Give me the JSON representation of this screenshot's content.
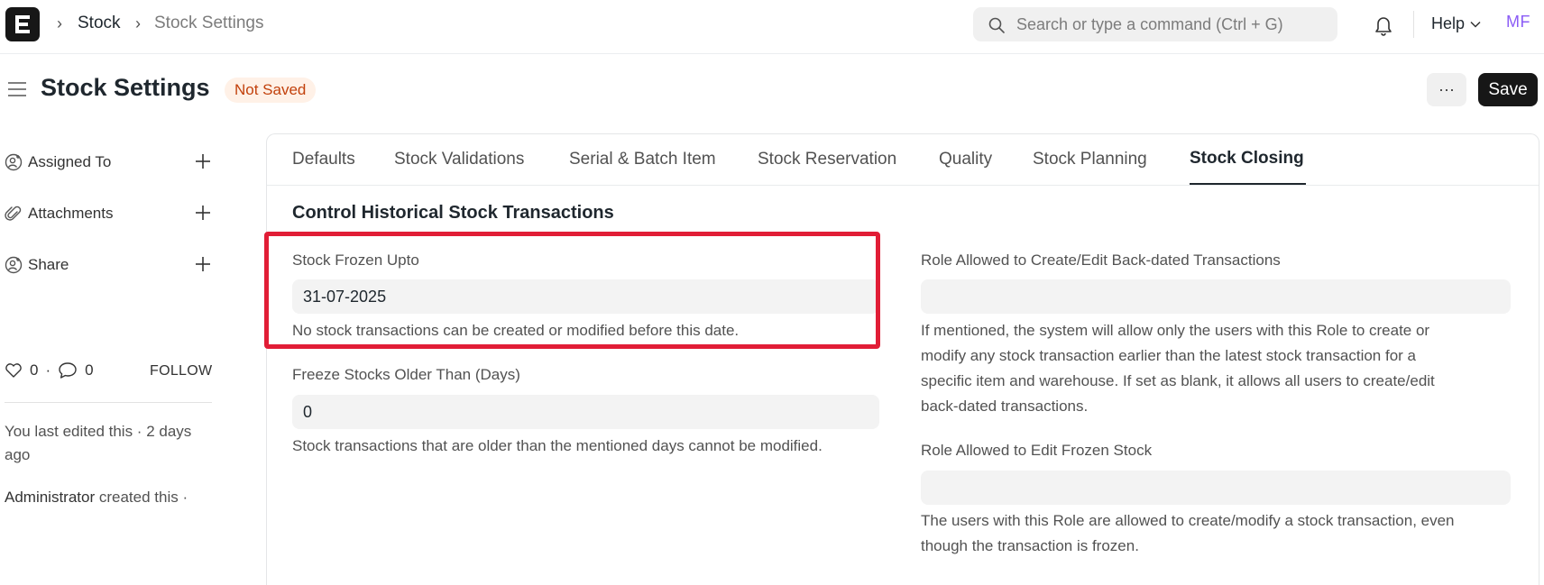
{
  "navbar": {
    "logo_letter": "E",
    "breadcrumbs": [
      "Stock",
      "Stock Settings"
    ],
    "search_placeholder": "Search or type a command (Ctrl + G)",
    "help_label": "Help",
    "avatar_initials": "MF"
  },
  "page": {
    "title": "Stock Settings",
    "status": "Not Saved",
    "more_label": "···",
    "save_label": "Save"
  },
  "sidebar": {
    "assigned_to": "Assigned To",
    "attachments": "Attachments",
    "share": "Share",
    "likes": "0",
    "comments": "0",
    "follow": "FOLLOW",
    "timeline": [
      "You last edited this · 2 days ago",
      "Administrator created this ·"
    ],
    "timeline_user": "Administrator",
    "timeline_action": " created this ·"
  },
  "tabs": [
    "Defaults",
    "Stock Validations",
    "Serial & Batch Item",
    "Stock Reservation",
    "Quality",
    "Stock Planning",
    "Stock Closing"
  ],
  "active_tab": "Stock Closing",
  "section": {
    "title": "Control Historical Stock Transactions",
    "fields": {
      "stock_frozen_upto": {
        "label": "Stock Frozen Upto",
        "value": "31-07-2025",
        "description": "No stock transactions can be created or modified before this date."
      },
      "freeze_stocks_older_than": {
        "label": "Freeze Stocks Older Than (Days)",
        "value": "0",
        "description": "Stock transactions that are older than the mentioned days cannot be modified."
      },
      "role_backdated": {
        "label": "Role Allowed to Create/Edit Back-dated Transactions",
        "value": "",
        "description_lines": [
          "If mentioned, the system will allow only the users with this Role to create or",
          "modify any stock transaction earlier than the latest stock transaction for a",
          "specific item and warehouse. If set as blank, it allows all users to create/edit",
          "back-dated transactions."
        ]
      },
      "role_frozen": {
        "label": "Role Allowed to Edit Frozen Stock",
        "value": "",
        "description_lines": [
          "The users with this Role are allowed to create/modify a stock transaction, even",
          "though the transaction is frozen."
        ]
      }
    }
  },
  "colors": {
    "highlight": "#e11d36",
    "status_text": "#c2410c",
    "status_bg": "#fff1e7",
    "avatar": "#8b5cf6"
  }
}
